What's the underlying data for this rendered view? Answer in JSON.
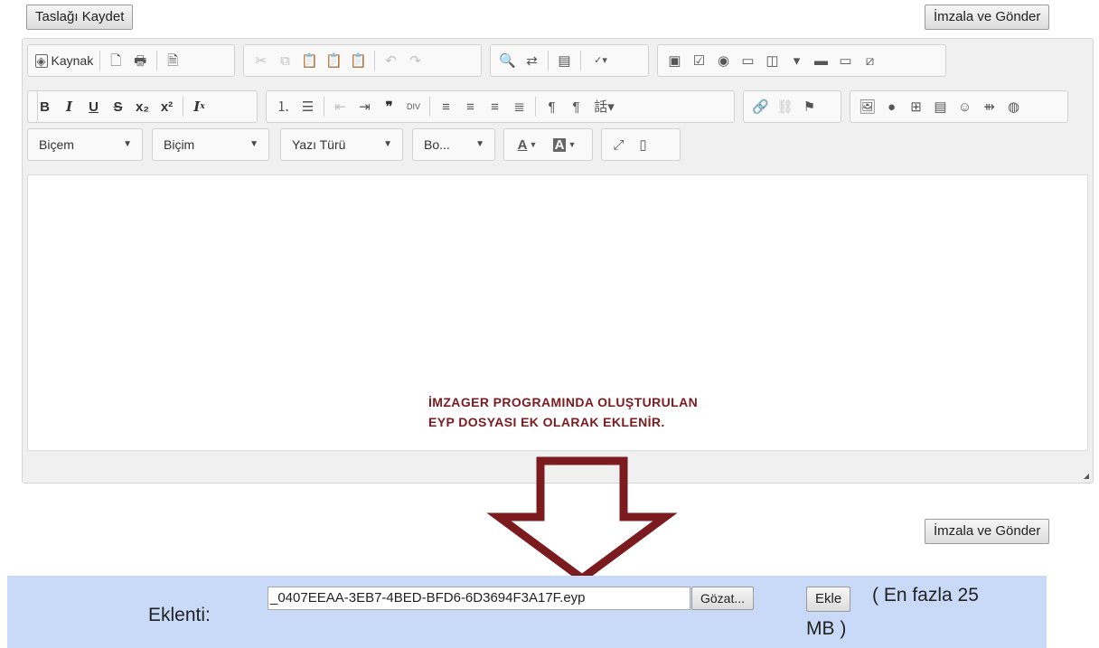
{
  "top_bar": {
    "save_draft": "Taslağı Kaydet",
    "sign_and_send": "İmzala ve Gönder"
  },
  "toolbar": {
    "source_label": "Kaynak",
    "combos": {
      "style": "Biçem",
      "format": "Biçim",
      "font": "Yazı Türü",
      "size": "Bo..."
    }
  },
  "annotation": {
    "line1": "İMZAGER PROGRAMINDA OLUŞTURULAN",
    "line2": "EYP DOSYASI EK OLARAK EKLENİR."
  },
  "bottom": {
    "sign_and_send": "İmzala ve Gönder"
  },
  "attachment": {
    "label": "Eklenti:",
    "file_value": "_0407EEAA-3EB7-4BED-BFD6-6D3694F3A17F.eyp",
    "browse": "Gözat...",
    "add": "Ekle",
    "limit_line1": "( En fazla 25",
    "limit_line2": "MB )"
  },
  "colors": {
    "annotation": "#7b1a1f",
    "attachment_bg": "#c9daf8",
    "editor_bg": "#f0f0f0"
  }
}
